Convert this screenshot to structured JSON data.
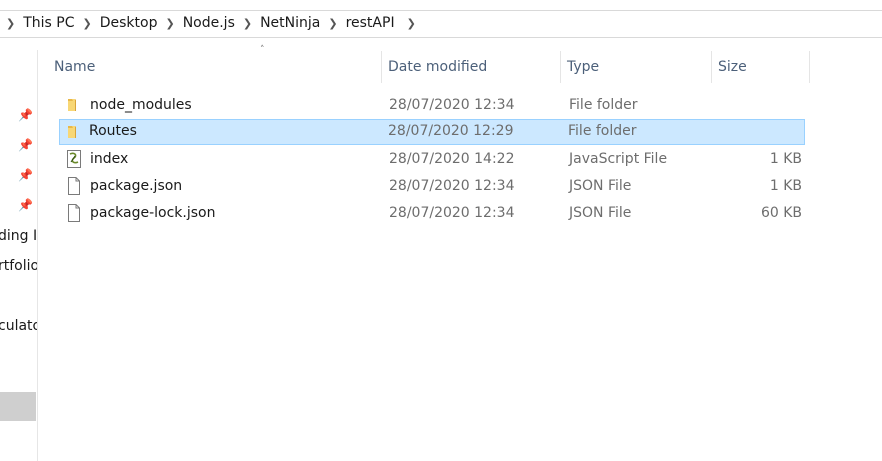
{
  "breadcrumb": {
    "items": [
      "This PC",
      "Desktop",
      "Node.js",
      "NetNinja",
      "restAPI"
    ]
  },
  "columns": {
    "name": "Name",
    "date_modified": "Date modified",
    "type": "Type",
    "size": "Size"
  },
  "nav": {
    "fragments": [
      "ding I",
      "rtfolio",
      "culato"
    ]
  },
  "files": [
    {
      "name": "node_modules",
      "date": "28/07/2020 12:34",
      "type": "File folder",
      "size": "",
      "icon": "folder-icon",
      "selected": false
    },
    {
      "name": "Routes",
      "date": "28/07/2020 12:29",
      "type": "File folder",
      "size": "",
      "icon": "folder-icon",
      "selected": true
    },
    {
      "name": "index",
      "date": "28/07/2020 14:22",
      "type": "JavaScript File",
      "size": "1 KB",
      "icon": "javascript-file-icon",
      "selected": false
    },
    {
      "name": "package.json",
      "date": "28/07/2020 12:34",
      "type": "JSON File",
      "size": "1 KB",
      "icon": "document-icon",
      "selected": false
    },
    {
      "name": "package-lock.json",
      "date": "28/07/2020 12:34",
      "type": "JSON File",
      "size": "60 KB",
      "icon": "document-icon",
      "selected": false
    }
  ],
  "colors": {
    "selection_bg": "#cce8ff",
    "selection_border": "#99d1ff",
    "header_text": "#4c607a",
    "folder": "#f8d775"
  }
}
